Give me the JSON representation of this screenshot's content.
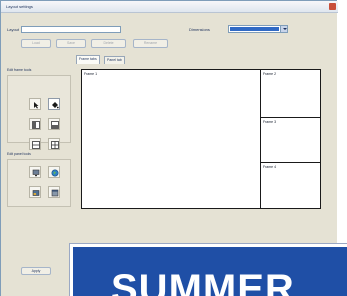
{
  "dialog": {
    "title": "Layout settings",
    "close_icon": "close-icon"
  },
  "top_form": {
    "layout_label": "Layout",
    "layout_placeholder": "",
    "dimension_label": "Dimensions",
    "dimension_value": "",
    "buttons": [
      "Load",
      "Save",
      "Delete",
      "Rename"
    ]
  },
  "toolbars": {
    "frame_tools_label": "Edit frame tools",
    "frame_tools": [
      "cursor-icon",
      "fill-icon",
      "split-vertical-icon",
      "split-horizontal-icon",
      "merge-icon",
      "grid-icon"
    ],
    "panel_tools_label": "Edit panel tools",
    "panel_tools": [
      "panel-monitor-icon",
      "panel-globe-icon",
      "panel-image-icon",
      "panel-window-icon"
    ]
  },
  "tabs": [
    "Frame tabs",
    "Panel tab"
  ],
  "frames": {
    "main": "Frame 1",
    "side_top": "Frame 2",
    "side_middle": "Frame 3",
    "side_bottom": "Frame 4"
  },
  "footer": {
    "apply_label": "Apply"
  },
  "banner": {
    "text": "SUMMER"
  }
}
